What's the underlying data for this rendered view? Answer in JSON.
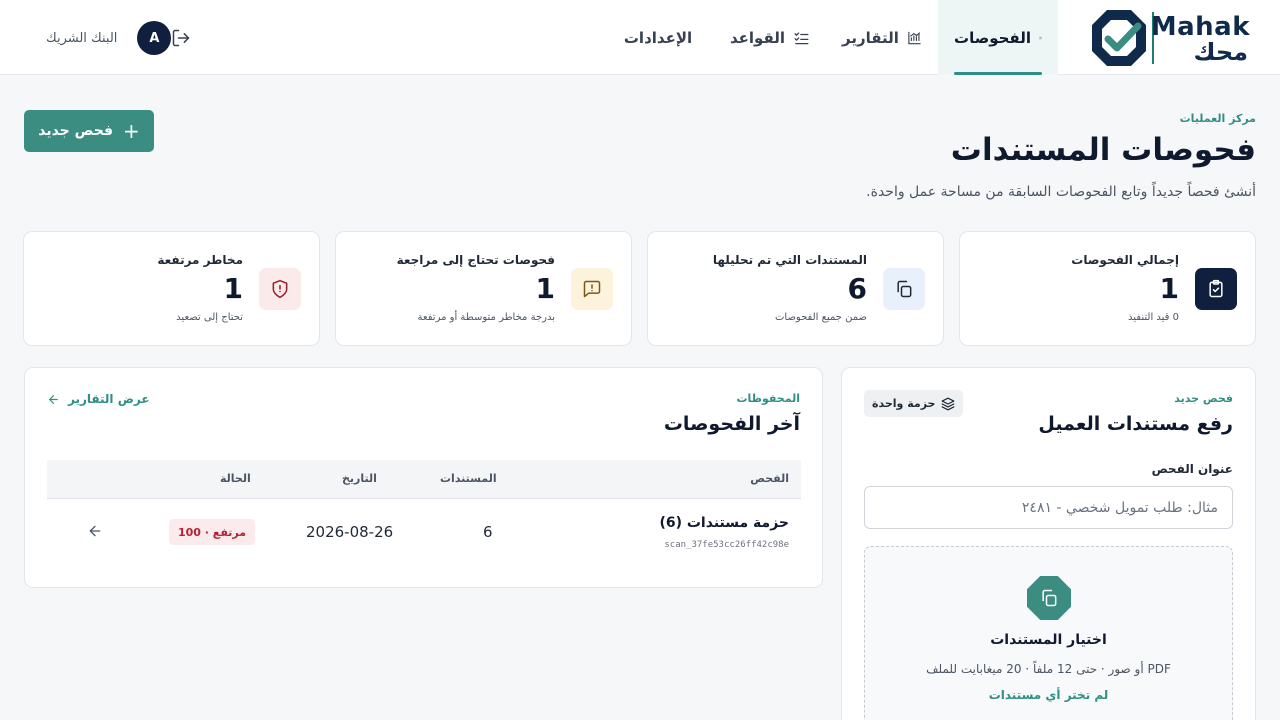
{
  "brand": {
    "name_en": "Mahak",
    "name_ar": "محك"
  },
  "nav": {
    "tabs": [
      {
        "label": "الفحوصات",
        "icon": "scan-search-icon",
        "active": true
      },
      {
        "label": "التقارير",
        "icon": "chart-icon",
        "active": false
      },
      {
        "label": "القواعد",
        "icon": "list-check-icon",
        "active": false
      },
      {
        "label": "الإعدادات",
        "icon": "gear-icon",
        "active": false
      }
    ]
  },
  "user": {
    "org": "البنك الشريك",
    "initial": "A",
    "logout_icon": "logout-icon"
  },
  "page": {
    "eyebrow": "مركز العمليات",
    "title": "فحوصات المستندات",
    "subtitle": "أنشئ فحصاً جديداً وتابع الفحوصات السابقة من مساحة عمل واحدة.",
    "new_button": "فحص جديد"
  },
  "stats": [
    {
      "label": "إجمالي الفحوصات",
      "value": "1",
      "note": "0 قيد التنفيذ",
      "icon": "clipboard-check-icon",
      "color": "#0f1f3d"
    },
    {
      "label": "المستندات التي تم تحليلها",
      "value": "6",
      "note": "ضمن جميع الفحوصات",
      "icon": "copy-icon",
      "color": "#e8f0fb"
    },
    {
      "label": "فحوصات تحتاج إلى مراجعة",
      "value": "1",
      "note": "بدرجة مخاطر متوسطة أو مرتفعة",
      "icon": "message-alert-icon",
      "color": "#fdf3dc"
    },
    {
      "label": "مخاطر مرتفعة",
      "value": "1",
      "note": "تحتاج إلى تصعيد",
      "icon": "shield-alert-icon",
      "color": "#fbeaea"
    }
  ],
  "upload": {
    "eyebrow": "فحص جديد",
    "title": "رفع مستندات العميل",
    "chip": "حزمة واحدة",
    "field_label": "عنوان الفحص",
    "field_placeholder": "مثال: طلب تمويل شخصي - ٢٤٨١",
    "dropzone_title": "اختيار المستندات",
    "dropzone_note": "PDF أو صور · حتى 12 ملفاً · 20 ميغابايت للملف",
    "dropzone_status": "لم تختر أي مستندات"
  },
  "recent": {
    "eyebrow": "المحفوظات",
    "title": "آخر الفحوصات",
    "view_link": "عرض التقارير",
    "columns": [
      "الفحص",
      "المستندات",
      "التاريخ",
      "الحالة"
    ],
    "rows": [
      {
        "name": "حزمة مستندات (6)",
        "id": "scan_37fe53cc26ff42c98e",
        "docs": "6",
        "date": "2026-08-26",
        "status": "مرتفع · 100"
      }
    ]
  }
}
